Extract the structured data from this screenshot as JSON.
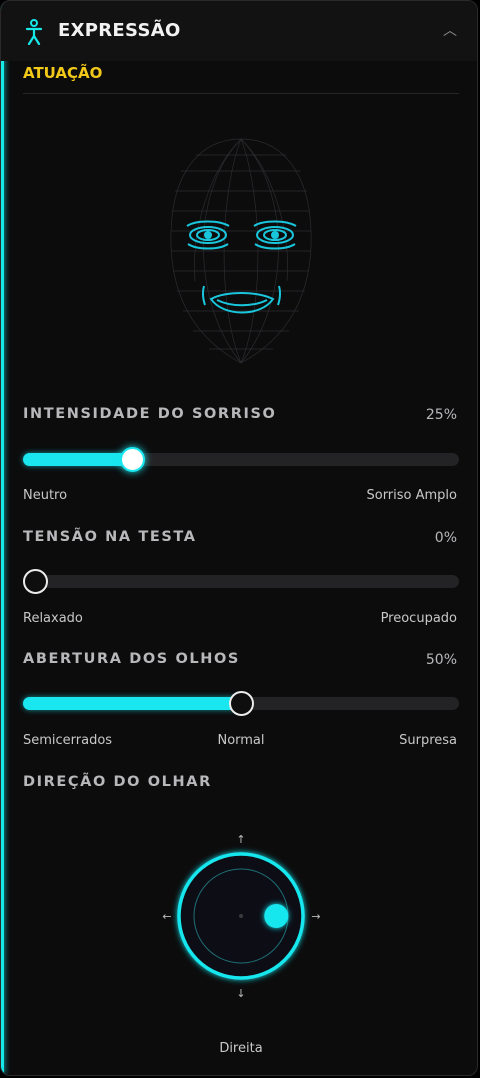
{
  "header": {
    "title": "EXPRESSÃO",
    "collapse_icon": "chevron-up-icon",
    "figure_icon": "person-figure-icon"
  },
  "section": {
    "label": "ATUAÇÃO"
  },
  "colors": {
    "accent": "#16e8e8",
    "section": "#f3c919",
    "panel": "#0c0c0d"
  },
  "sliders": [
    {
      "title": "INTENSIDADE DO SORRISO",
      "value_text": "25%",
      "value": 0.25,
      "labels": [
        "Neutro",
        "Sorriso Amplo"
      ]
    },
    {
      "title": "TENSÃO NA TESTA",
      "value_text": "0%",
      "value": 0.0,
      "labels": [
        "Relaxado",
        "Preocupado"
      ]
    },
    {
      "title": "ABERTURA DOS OLHOS",
      "value_text": "50%",
      "value": 0.5,
      "labels": [
        "Semicerrados",
        "Normal",
        "Surpresa"
      ]
    }
  ],
  "gaze": {
    "title": "DIREÇÃO DO OLHAR",
    "readout": "Direita",
    "direction_x": 0.75,
    "direction_y": 0.0
  }
}
